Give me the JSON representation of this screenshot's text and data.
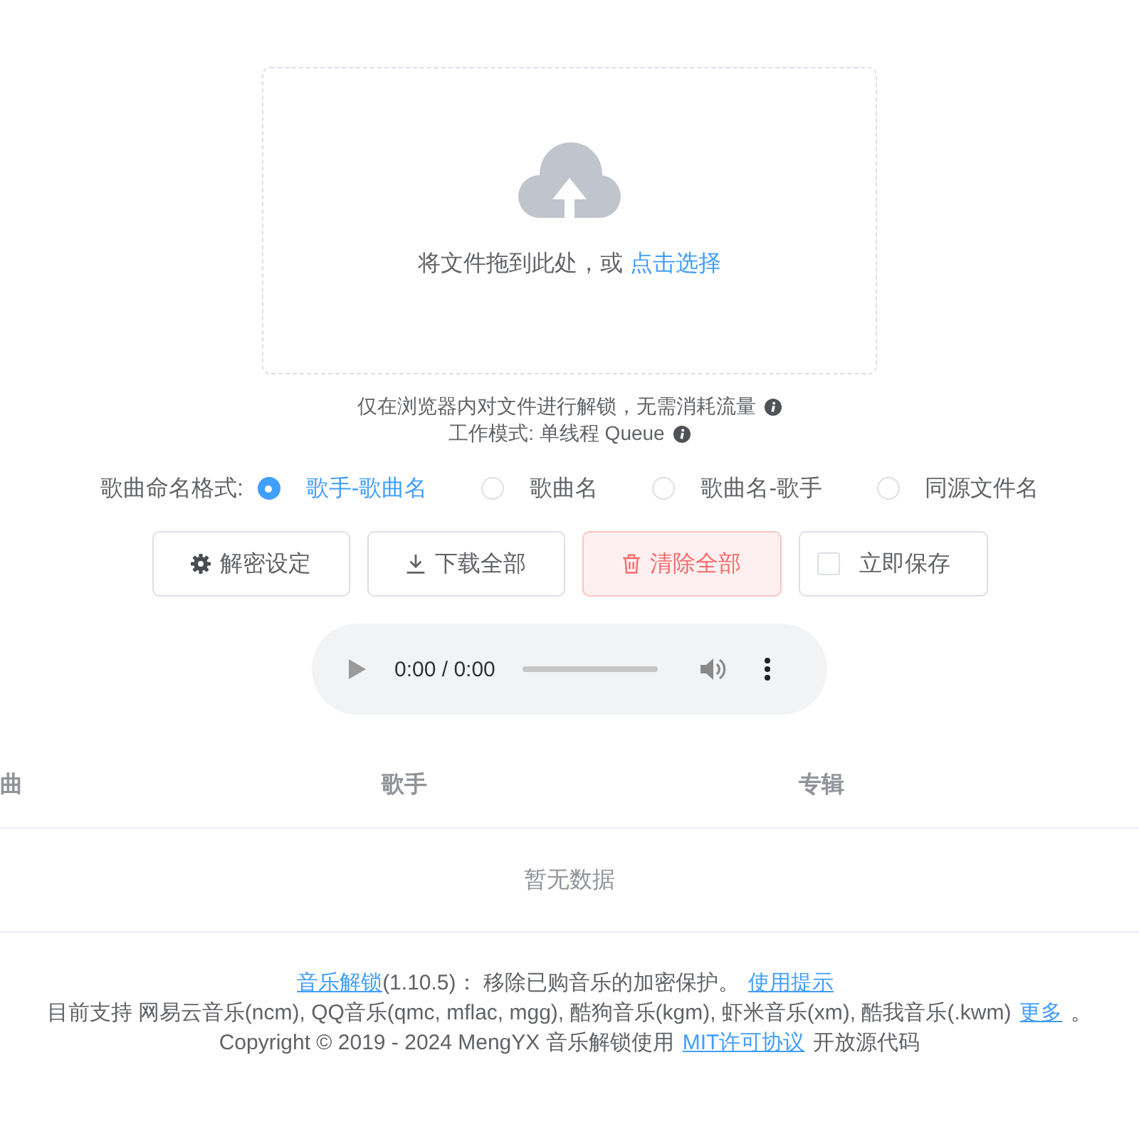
{
  "upload": {
    "prompt": "将文件拖到此处，或",
    "link": "点击选择"
  },
  "hints": [
    "仅在浏览器内对文件进行解锁，无需消耗流量",
    "工作模式: 单线程 Queue"
  ],
  "naming_format": {
    "label": "歌曲命名格式:",
    "options": [
      {
        "label": "歌手-歌曲名",
        "selected": true
      },
      {
        "label": "歌曲名",
        "selected": false
      },
      {
        "label": "歌曲名-歌手",
        "selected": false
      },
      {
        "label": "同源文件名",
        "selected": false
      }
    ]
  },
  "buttons": [
    {
      "kind": "settings",
      "label": "解密设定"
    },
    {
      "kind": "download",
      "label": "下载全部"
    },
    {
      "kind": "delete",
      "label": "清除全部"
    },
    {
      "kind": "checkbox",
      "label": "立即保存",
      "checked": false
    }
  ],
  "player": {
    "time": "0:00 / 0:00"
  },
  "table": {
    "columns": [
      "曲",
      "歌手",
      "专辑"
    ],
    "empty_text": "暂无数据"
  },
  "footer": {
    "lines": [
      {
        "segments": [
          {
            "kind": "link",
            "text": "音乐解锁"
          },
          {
            "kind": "text",
            "text": "(1.10.5)： 移除已购音乐的加密保护。"
          },
          {
            "kind": "link",
            "text": "使用提示"
          }
        ]
      },
      {
        "segments": [
          {
            "kind": "text",
            "text": "目前支持 网易云音乐(ncm), QQ音乐(qmc, mflac, mgg), 酷狗音乐(kgm), 虾米音乐(xm), 酷我音乐(.kwm)"
          },
          {
            "kind": "link",
            "text": "更多"
          },
          {
            "kind": "text",
            "text": "。"
          }
        ]
      },
      {
        "segments": [
          {
            "kind": "text",
            "text": "Copyright © 2019 - 2024 MengYX 音乐解锁使用"
          },
          {
            "kind": "link",
            "text": "MIT许可协议"
          },
          {
            "kind": "text",
            "text": "开放源代码"
          }
        ]
      }
    ]
  }
}
